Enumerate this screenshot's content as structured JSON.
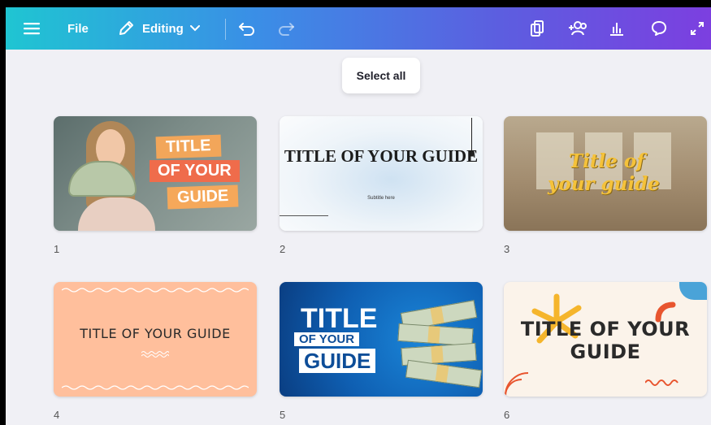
{
  "toolbar": {
    "menu_icon": "hamburger-menu-icon",
    "file_label": "File",
    "editing_label": "Editing",
    "right_icons": [
      "pages-icon",
      "add-people-icon",
      "insights-chart-icon",
      "comment-icon",
      "expand-icon"
    ]
  },
  "select_all_label": "Select all",
  "slides": [
    {
      "number": "1",
      "lines": [
        "TITLE",
        "OF YOUR",
        "GUIDE"
      ]
    },
    {
      "number": "2",
      "title": "TITLE OF YOUR GUIDE",
      "subtitle": "Subtitle here"
    },
    {
      "number": "3",
      "lines": [
        "Title of",
        "your guide"
      ]
    },
    {
      "number": "4",
      "title": "TITLE OF YOUR GUIDE"
    },
    {
      "number": "5",
      "lines": [
        "TITLE",
        "OF YOUR",
        "GUIDE"
      ]
    },
    {
      "number": "6",
      "title": "TITLE OF YOUR GUIDE"
    }
  ],
  "colors": {
    "gradient_start": "#1fc5d2",
    "gradient_end": "#7c3fe0",
    "canvas_bg": "#f0f0f5"
  }
}
